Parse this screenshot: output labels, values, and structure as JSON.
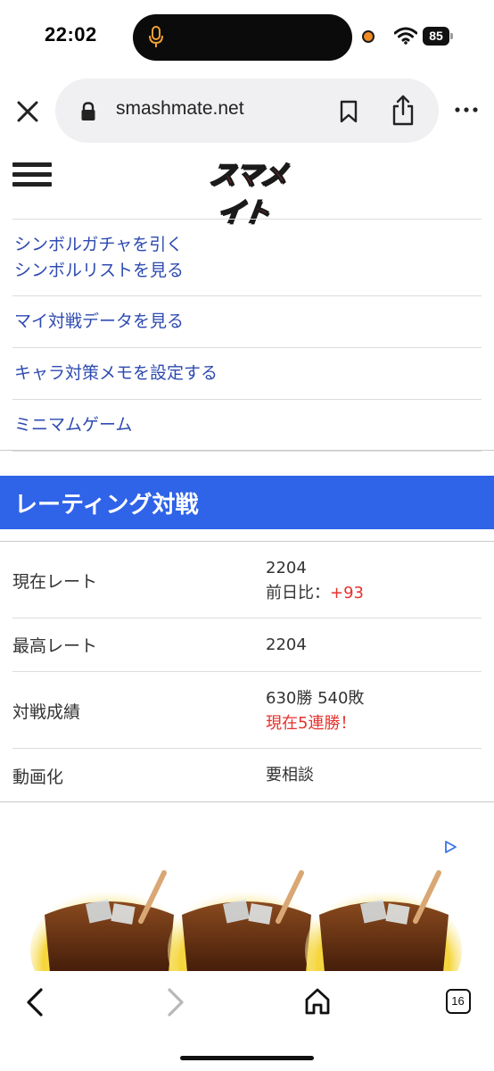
{
  "status_bar": {
    "time": "22:02",
    "battery": "85"
  },
  "browser": {
    "url": "smashmate.net",
    "tab_count": "16"
  },
  "site": {
    "logo_text": "スマメイト"
  },
  "links": [
    {
      "lines": [
        "シンボルガチャを引く",
        "シンボルリストを見る"
      ]
    },
    {
      "lines": [
        "マイ対戦データを見る"
      ]
    },
    {
      "lines": [
        "キャラ対策メモを設定する"
      ]
    },
    {
      "lines": [
        "ミニマムゲーム"
      ]
    }
  ],
  "rating": {
    "title": "レーティング対戦",
    "rows": [
      {
        "label": "現在レート",
        "value": "2204",
        "sub_label": "前日比：",
        "sub_value": "+93"
      },
      {
        "label": "最高レート",
        "value": "2204"
      },
      {
        "label": "対戦成績",
        "value": "630勝 540敗",
        "sub_value": "現在5連勝！"
      },
      {
        "label": "動画化",
        "value": "要相談"
      }
    ]
  },
  "colors": {
    "accent": "#2f63e8",
    "link": "#2e4bb0",
    "highlight": "#e5322d"
  }
}
